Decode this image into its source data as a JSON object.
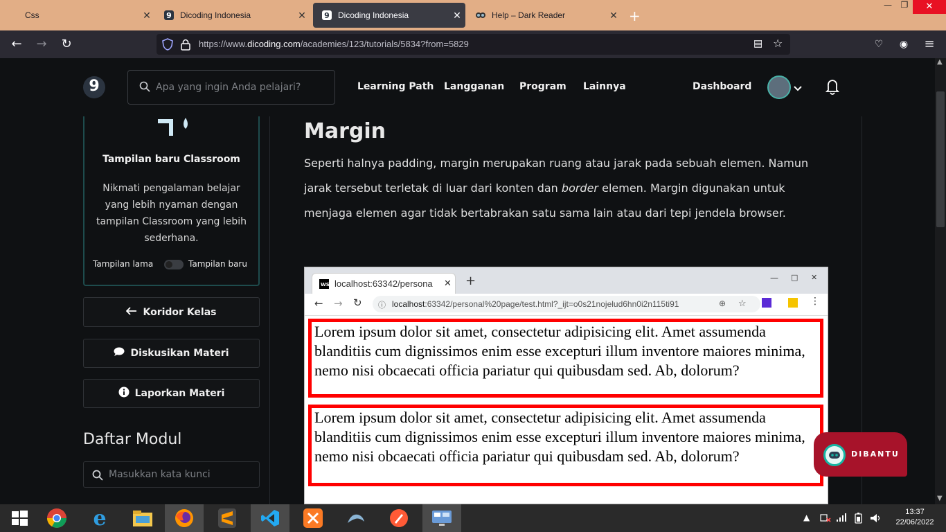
{
  "browser": {
    "tabs": [
      {
        "title": "Css"
      },
      {
        "title": "Dicoding Indonesia"
      },
      {
        "title": "Dicoding Indonesia"
      },
      {
        "title": "Help – Dark Reader"
      }
    ],
    "url_prefix": "https://www.",
    "url_host": "dicoding.com",
    "url_path": "/academies/123/tutorials/5834?from=5829"
  },
  "site": {
    "logo": "9",
    "search_placeholder": "Apa yang ingin Anda pelajari?",
    "menu": [
      "Learning Path",
      "Langganan",
      "Program",
      "Lainnya"
    ],
    "dashboard": "Dashboard"
  },
  "sidebar": {
    "classroom_title": "Tampilan baru Classroom",
    "classroom_desc": "Nikmati pengalaman belajar yang lebih nyaman dengan tampilan Classroom yang lebih sederhana.",
    "toggle_old": "Tampilan lama",
    "toggle_new": "Tampilan baru",
    "btn_koridor": "Koridor Kelas",
    "btn_diskusi": "Diskusikan Materi",
    "btn_lapor": "Laporkan Materi",
    "module_title": "Daftar Modul",
    "module_search_placeholder": "Masukkan kata kunci"
  },
  "content": {
    "heading": "Margin",
    "para_1": "Seperti halnya padding, margin merupakan ruang atau jarak pada sebuah elemen. Namun jarak tersebut terletak di luar dari konten dan ",
    "para_italic": "border",
    "para_2": " elemen. Margin digunakan untuk menjaga elemen agar tidak bertabrakan satu sama lain atau dari tepi jendela browser."
  },
  "screenshot": {
    "tab_title": "localhost:63342/persona",
    "url_host": "localhost",
    "url_rest": ":63342/personal%20page/test.html?_ijt=o0s21nojelud6hn0i2n115ti91",
    "box_text": "Lorem ipsum dolor sit amet, consectetur adipisicing elit. Amet assumenda blanditiis cum dignissimos enim esse excepturi illum inventore maiores minima, nemo nisi obcaecati officia pariatur qui quibusdam sed. Ab, dolorum?"
  },
  "chat": {
    "label": "DIBANTU"
  },
  "taskbar": {
    "time": "13:37",
    "date": "22/06/2022"
  },
  "colors": {
    "accent_red": "#ff0000",
    "chat_bg": "#a7132a",
    "tab_bar": "#e2ae86"
  }
}
